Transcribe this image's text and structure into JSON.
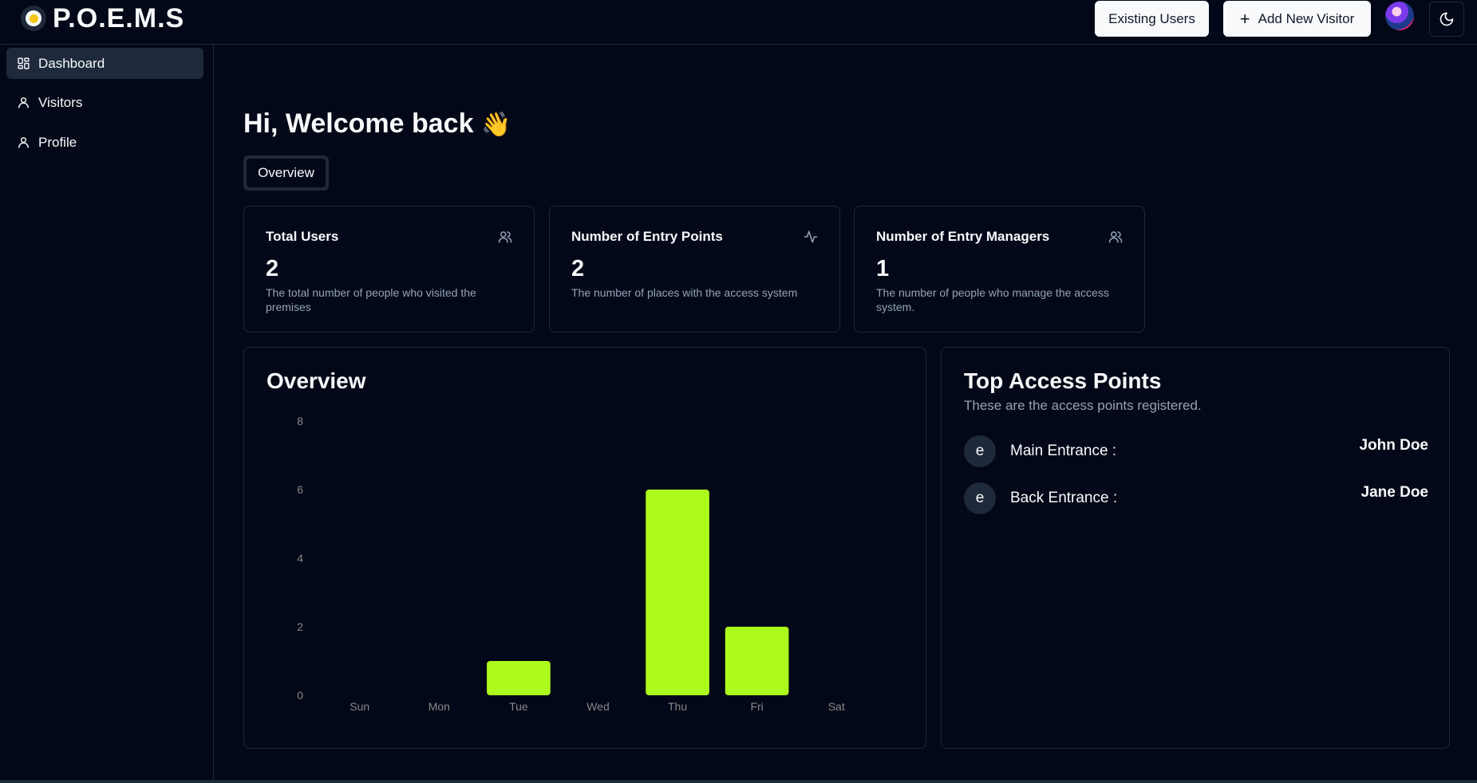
{
  "app": {
    "name": "P.O.E.M.S"
  },
  "header": {
    "existing_users_label": "Existing Users",
    "add_visitor_label": "Add New Visitor"
  },
  "sidebar": {
    "items": [
      {
        "label": "Dashboard",
        "icon": "dashboard-icon",
        "active": true
      },
      {
        "label": "Visitors",
        "icon": "user-icon",
        "active": false
      },
      {
        "label": "Profile",
        "icon": "user-icon",
        "active": false
      }
    ]
  },
  "main": {
    "greeting": "Hi, Welcome back",
    "greeting_emoji": "👋",
    "tabs": [
      {
        "label": "Overview"
      }
    ],
    "stats": [
      {
        "title": "Total Users",
        "value": "2",
        "description": "The total number of people who visited the premises",
        "icon": "users-icon"
      },
      {
        "title": "Number of Entry Points",
        "value": "2",
        "description": "The number of places with the access system",
        "icon": "activity-icon"
      },
      {
        "title": "Number of Entry Managers",
        "value": "1",
        "description": "The number of people who manage the access system.",
        "icon": "users-icon"
      }
    ],
    "overview_title": "Overview",
    "access": {
      "title": "Top Access Points",
      "subtitle": "These are the access points registered.",
      "rows": [
        {
          "initial": "e",
          "name": "Main Entrance :",
          "person": "John Doe"
        },
        {
          "initial": "e",
          "name": "Back Entrance :",
          "person": "Jane Doe"
        }
      ]
    }
  },
  "colors": {
    "background": "#020817",
    "border": "#1e293b",
    "bar": "#adfa1d",
    "muted": "#94a3b8"
  },
  "chart_data": {
    "type": "bar",
    "categories": [
      "Sun",
      "Mon",
      "Tue",
      "Wed",
      "Thu",
      "Fri",
      "Sat"
    ],
    "values": [
      0,
      0,
      1,
      0,
      6,
      2,
      0
    ],
    "yticks": [
      0,
      2,
      4,
      6,
      8
    ],
    "ylim": [
      0,
      8
    ],
    "grid": false
  }
}
